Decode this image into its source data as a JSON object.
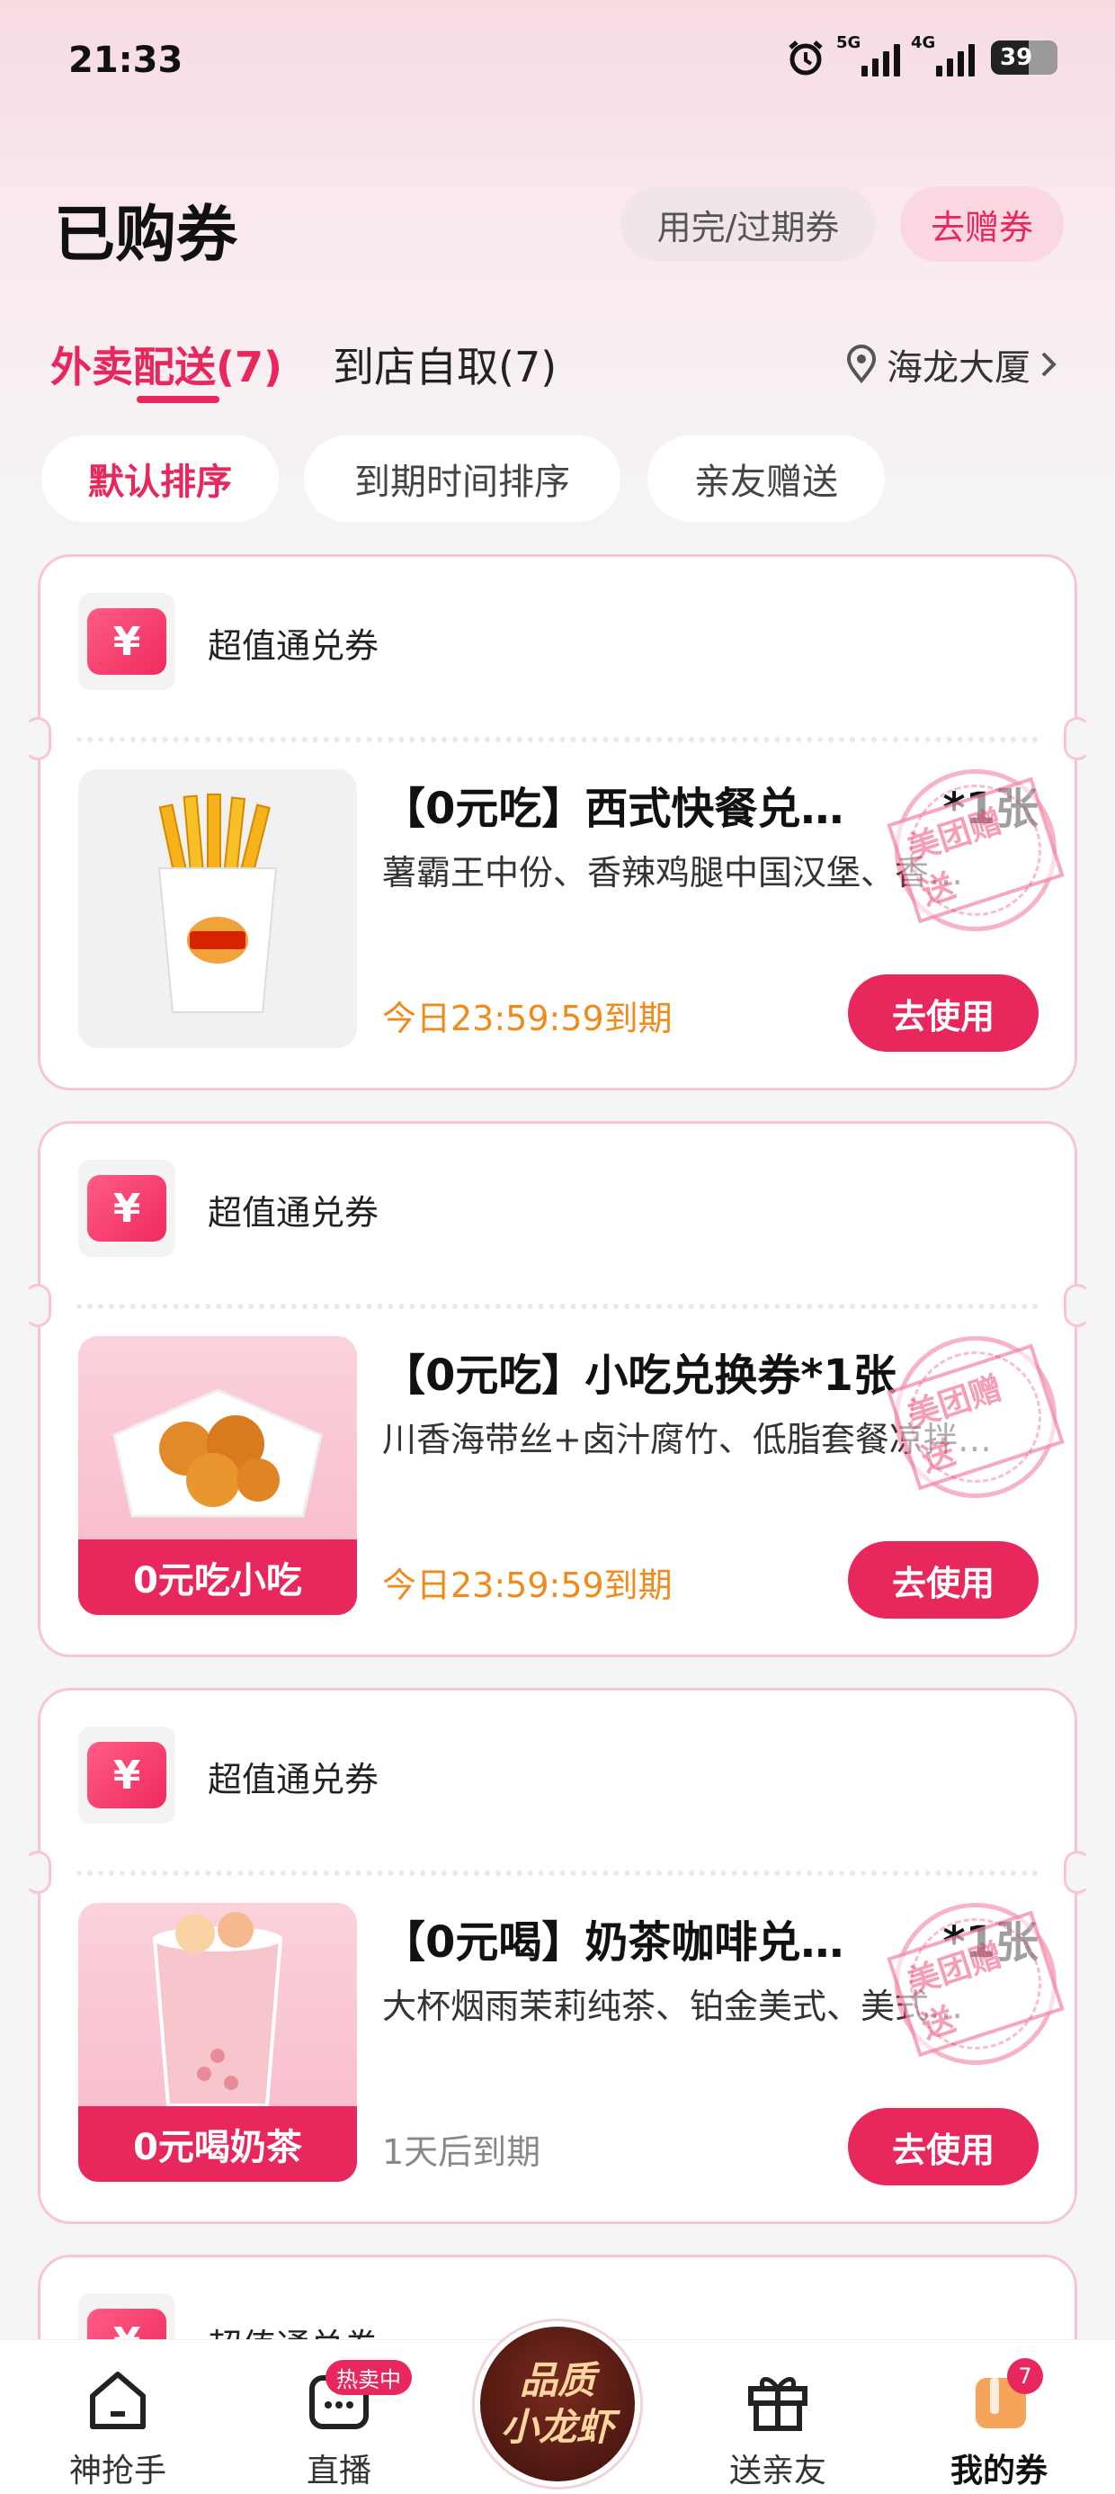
{
  "status_bar": {
    "time": "21:33",
    "net1": "5G",
    "net2": "4G",
    "battery": "39"
  },
  "header": {
    "title": "已购券",
    "expired_label": "用完/过期券",
    "gift_label": "去赠券"
  },
  "tabs": {
    "delivery": "外卖配送(7)",
    "pickup": "到店自取(7)",
    "location": "海龙大厦"
  },
  "sort": {
    "default": "默认排序",
    "expiry": "到期时间排序",
    "friends": "亲友赠送"
  },
  "coupons": [
    {
      "type_label": "超值通兑券",
      "type_icon": "¥",
      "title": "【0元吃】西式快餐兑…",
      "qty": "*1张",
      "desc": "薯霸王中份、香辣鸡腿中国汉堡、香…",
      "expire": "今日23:59:59到期",
      "stamp": "美团赠送",
      "button": "去使用"
    },
    {
      "type_label": "超值通兑券",
      "type_icon": "¥",
      "title": "【0元吃】小吃兑换券*1张",
      "qty": "",
      "desc": "川香海带丝+卤汁腐竹、低脂套餐凉拌…",
      "expire": "今日23:59:59到期",
      "stamp": "美团赠送",
      "thumb_label": "0元吃小吃",
      "button": "去使用"
    },
    {
      "type_label": "超值通兑券",
      "type_icon": "¥",
      "title": "【0元喝】奶茶咖啡兑…",
      "qty": "*1张",
      "desc": "大杯烟雨茉莉纯茶、铂金美式、美式…",
      "expire": "1天后到期",
      "stamp": "美团赠送",
      "thumb_label": "0元喝奶茶",
      "button": "去使用"
    },
    {
      "type_label": "超值通兑券",
      "type_icon": "¥"
    }
  ],
  "bottom_nav": {
    "grab": "神抢手",
    "live": "直播",
    "live_badge": "热卖中",
    "center_line1": "品质",
    "center_line2": "小龙虾",
    "gift": "送亲友",
    "mine": "我的券",
    "mine_badge": "7"
  },
  "colors": {
    "accent": "#e8285c",
    "expire_orange": "#f08a1a"
  }
}
